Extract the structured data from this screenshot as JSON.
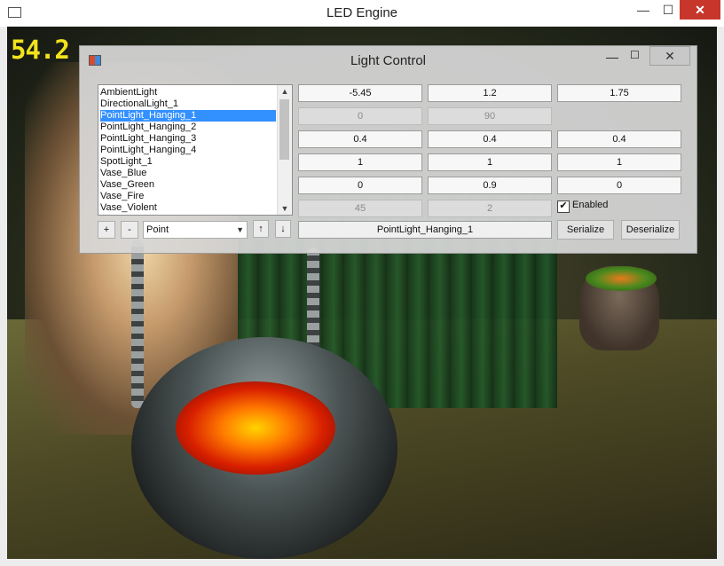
{
  "window": {
    "title": "LED Engine"
  },
  "scene": {
    "fps": "54.2"
  },
  "dialog": {
    "title": "Light Control",
    "lights": [
      "AmbientLight",
      "DirectionalLight_1",
      "PointLight_Hanging_1",
      "PointLight_Hanging_2",
      "PointLight_Hanging_3",
      "PointLight_Hanging_4",
      "SpotLight_1",
      "Vase_Blue",
      "Vase_Green",
      "Vase_Fire",
      "Vase_Violent"
    ],
    "selected_light": "PointLight_Hanging_1",
    "buttons": {
      "add": "+",
      "remove": "-",
      "up": "↑",
      "down": "↓",
      "serialize": "Serialize",
      "deserialize": "Deserialize"
    },
    "type_select": "Point",
    "rows": [
      [
        "-5.45",
        "1.2",
        "1.75"
      ],
      [
        "0",
        "90",
        ""
      ],
      [
        "0.4",
        "0.4",
        "0.4"
      ],
      [
        "1",
        "1",
        "1"
      ],
      [
        "0",
        "0.9",
        "0"
      ],
      [
        "45",
        "2",
        ""
      ]
    ],
    "enabled_label": "Enabled",
    "enabled": true,
    "name_value": "PointLight_Hanging_1"
  }
}
